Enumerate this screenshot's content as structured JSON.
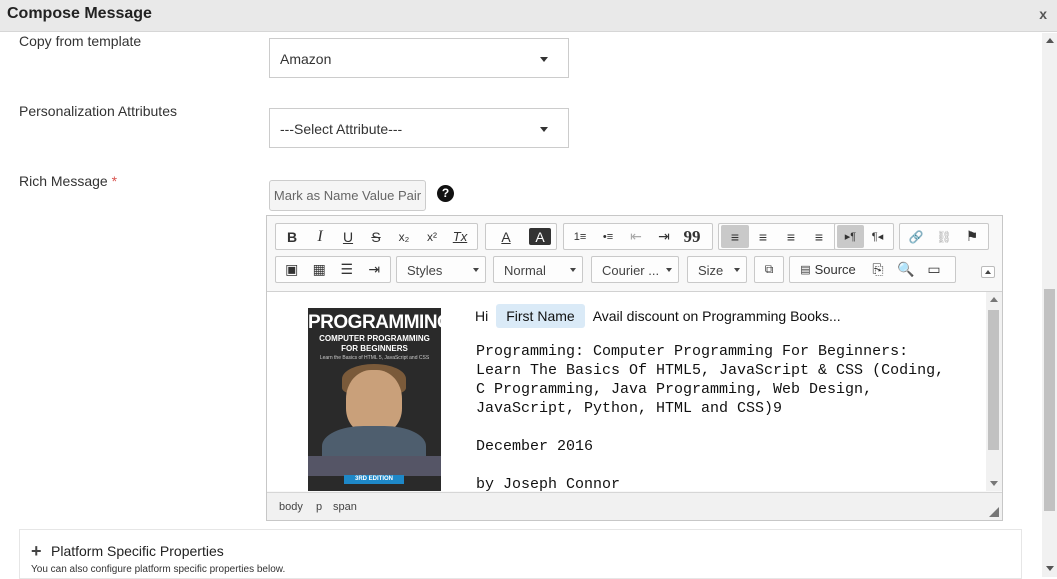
{
  "dialog": {
    "title": "Compose Message",
    "close": "x"
  },
  "form": {
    "template_label": "Copy from template",
    "template_value": "Amazon",
    "attr_label": "Personalization Attributes",
    "attr_value": "---Select Attribute---",
    "rich_label": "Rich Message",
    "required_mark": "*",
    "mark_button": "Mark as Name Value Pair",
    "help": "?"
  },
  "toolbar": {
    "row1": {
      "basic": [
        "B",
        "I",
        "U",
        "S",
        "x₂",
        "x²",
        "Tx"
      ],
      "colors": [
        "A",
        "A"
      ],
      "lists": [
        "1≡",
        "•≡",
        "⇤",
        "⇥",
        "99"
      ],
      "align": [
        "≡",
        "≡",
        "≡",
        "≡"
      ],
      "dir": [
        "▸¶",
        "¶◂"
      ],
      "links": [
        "🔗",
        "⛓",
        "⚑"
      ]
    },
    "row2": {
      "insert": [
        "▣",
        "▦",
        "☰",
        "⇥"
      ],
      "styles": "Styles",
      "format": "Normal",
      "font": "Courier ...",
      "size": "Size",
      "source": "Source"
    }
  },
  "content": {
    "book": {
      "title": "PROGRAMMING",
      "subtitle1": "COMPUTER PROGRAMMING",
      "subtitle2": "FOR BEGINNERS",
      "tagline": "Learn the Basics of HTML 5, JavaScript and CSS",
      "edition": "3RD EDITION"
    },
    "hi": "Hi",
    "chip": "First Name",
    "offer": "Avail discount on Programming Books...",
    "line1": "Programming: Computer Programming For Beginners:",
    "line2": "Learn The Basics Of HTML5, JavaScript & CSS (Coding,",
    "line3": "C Programming, Java Programming, Web Design,",
    "line4": "JavaScript, Python, HTML and CSS)9",
    "date": "December 2016",
    "author": "by Joseph Connor"
  },
  "statusbar": {
    "path": [
      "body",
      "p",
      "span"
    ]
  },
  "platform": {
    "title": "Platform Specific Properties",
    "subtitle": "You can also configure platform specific properties below."
  }
}
